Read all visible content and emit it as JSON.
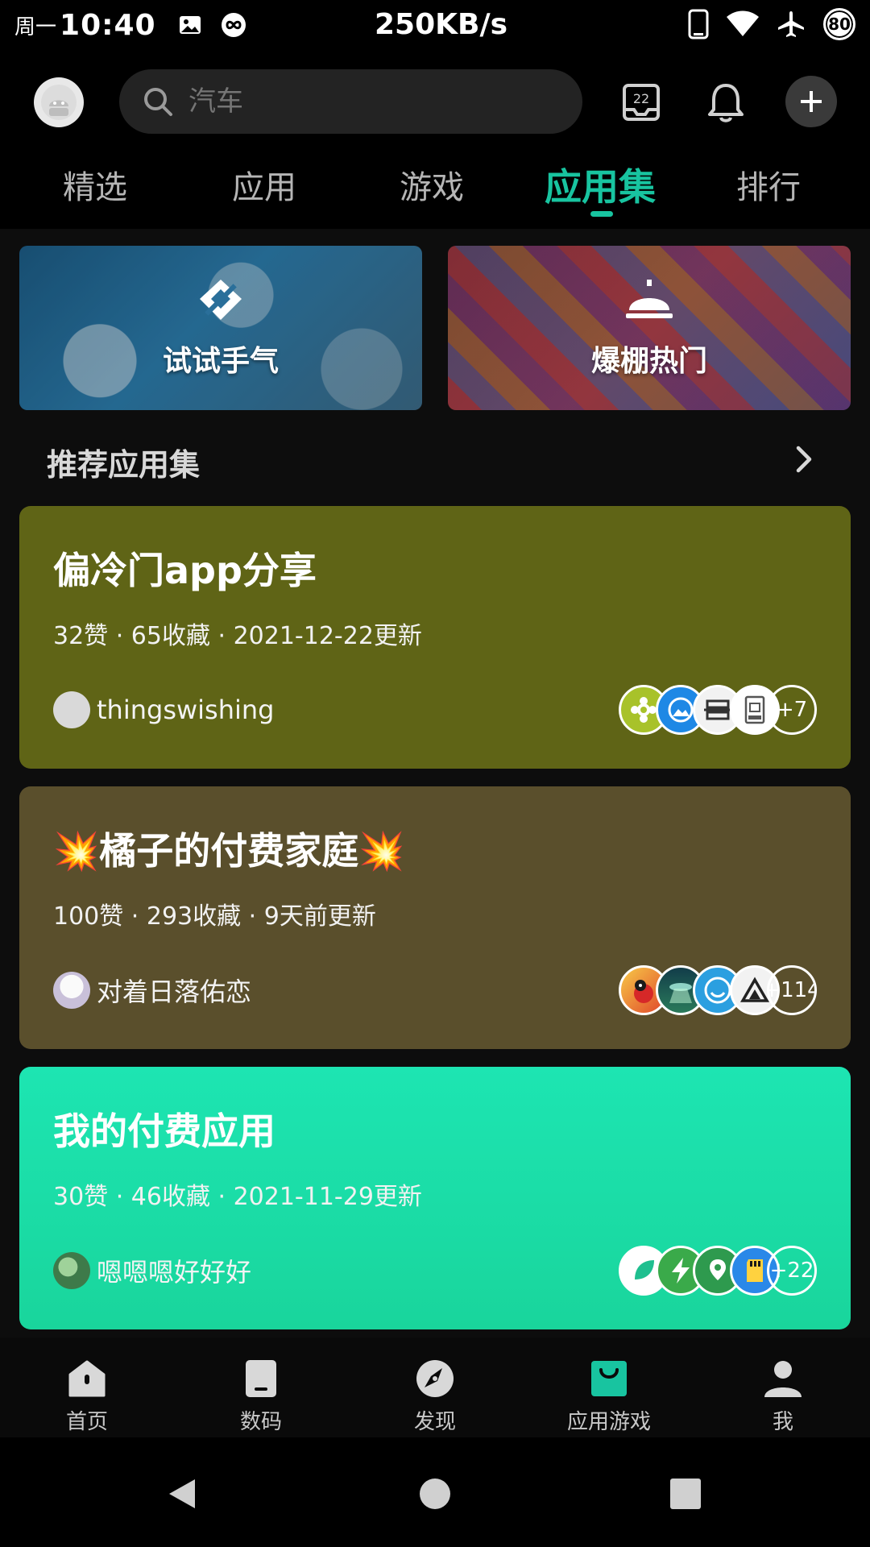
{
  "status_bar": {
    "day": "周一",
    "time": "10:40",
    "speed": "250KB/s",
    "battery": "80"
  },
  "header": {
    "search_placeholder": "汽车",
    "calendar_day": "22"
  },
  "tabs": [
    {
      "label": "精选",
      "active": false
    },
    {
      "label": "应用",
      "active": false
    },
    {
      "label": "游戏",
      "active": false
    },
    {
      "label": "应用集",
      "active": true
    },
    {
      "label": "排行",
      "active": false
    }
  ],
  "banners": [
    {
      "label": "试试手气",
      "icon": "dice-icon"
    },
    {
      "label": "爆棚热门",
      "icon": "bell-service-icon"
    }
  ],
  "section": {
    "title": "推荐应用集"
  },
  "collections": [
    {
      "title": "偏冷门app分享",
      "meta": "32赞 · 65收藏 · 2021-12-22更新",
      "author": "thingswishing",
      "more_count": "+7",
      "bg": "#5f6416"
    },
    {
      "title": "💥橘子的付费家庭💥",
      "meta": "100赞 · 293收藏 · 9天前更新",
      "author": "对着日落佑恋",
      "more_count": "+114",
      "bg": "#5a4f2c"
    },
    {
      "title": "我的付费应用",
      "meta": "30赞 · 46收藏 · 2021-11-29更新",
      "author": "嗯嗯嗯好好好",
      "more_count": "+22",
      "bg": "#1be0a6"
    }
  ],
  "bottom_nav": [
    {
      "label": "首页",
      "icon": "home-icon",
      "active": false
    },
    {
      "label": "数码",
      "icon": "device-icon",
      "active": false
    },
    {
      "label": "发现",
      "icon": "compass-icon",
      "active": false
    },
    {
      "label": "应用游戏",
      "icon": "shopping-bag-icon",
      "active": true
    },
    {
      "label": "我",
      "icon": "profile-icon",
      "active": false
    }
  ],
  "colors": {
    "accent": "#18c4a0",
    "background": "#0d0d0d"
  }
}
